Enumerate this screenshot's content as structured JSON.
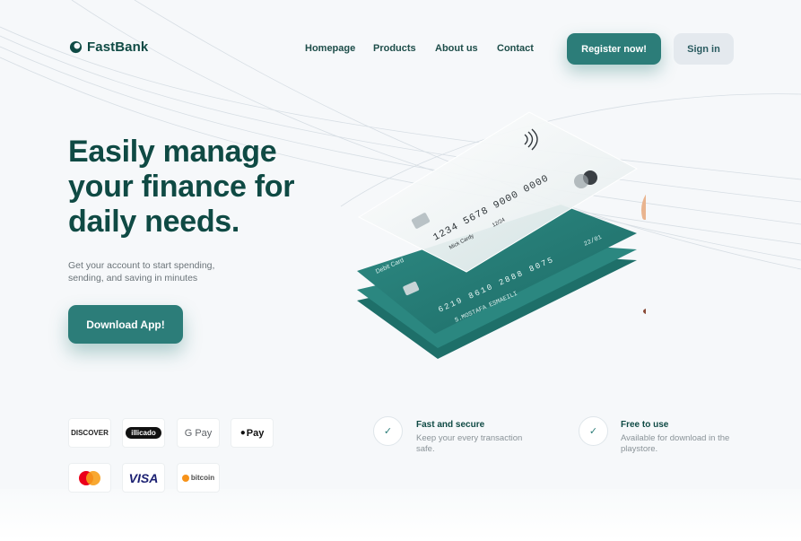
{
  "brand": {
    "name": "FastBank"
  },
  "nav": {
    "items": [
      {
        "label": "Homepage"
      },
      {
        "label": "Products"
      },
      {
        "label": "About us"
      },
      {
        "label": "Contact"
      }
    ],
    "register_label": "Register now!",
    "signin_label": "Sign in"
  },
  "hero": {
    "title_line1": "Easily manage",
    "title_line2": "your finance for",
    "title_line3": "daily needs.",
    "subtitle_line1": "Get your account to start spending,",
    "subtitle_line2": "sending, and saving in minutes",
    "cta_label": "Download App!"
  },
  "cards": {
    "top": {
      "number": "1234 5678 9000 0000",
      "name": "Mick Cardy",
      "expiry": "12/24"
    },
    "debit": {
      "type": "Debit Card",
      "number": "6219 8610 2888 8075",
      "holder": "S.MOSTAFA ESMAEILI",
      "expiry": "22/01"
    }
  },
  "payments": [
    {
      "name": "DISCOVER",
      "icon": "discover-logo"
    },
    {
      "name": "illicado",
      "icon": "illicado-logo"
    },
    {
      "name": "G Pay",
      "icon": "google-pay-logo"
    },
    {
      "name": "Pay",
      "icon": "apple-pay-logo"
    },
    {
      "name": "mastercard",
      "icon": "mastercard-logo"
    },
    {
      "name": "VISA",
      "icon": "visa-logo"
    },
    {
      "name": "bitcoin",
      "icon": "bitcoin-logo"
    }
  ],
  "features": [
    {
      "title": "Fast and secure",
      "desc_line1": "Keep your every transaction",
      "desc_line2": "safe.",
      "icon": "check-icon"
    },
    {
      "title": "Free to use",
      "desc_line1": "Available for download in the",
      "desc_line2": "playstore.",
      "icon": "check-icon"
    }
  ],
  "colors": {
    "primary": "#2c7d79",
    "dark": "#0f4a44",
    "secondary_btn": "#e4e9ee",
    "background": "#f6f8fa"
  }
}
